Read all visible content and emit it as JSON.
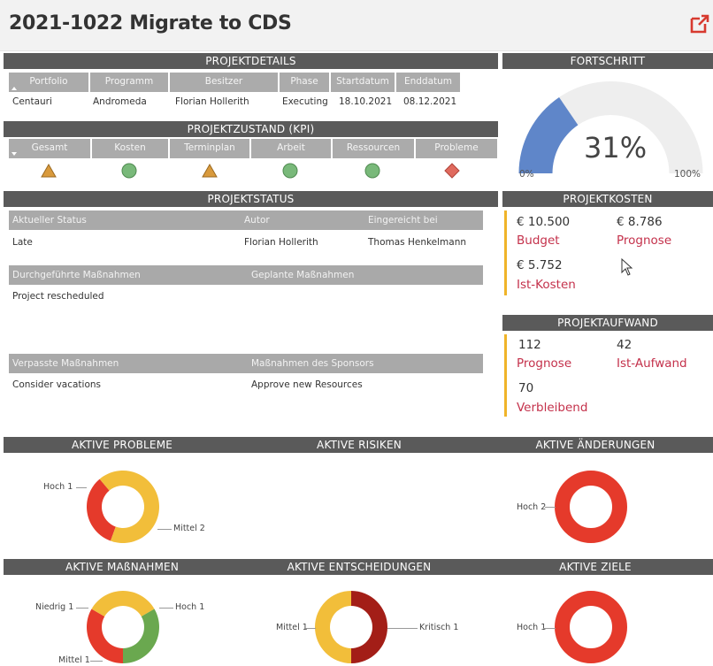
{
  "header": {
    "title": "2021-1022 Migrate to CDS"
  },
  "sections": {
    "projektdetails": "PROJEKTDETAILS",
    "fortschritt": "FORTSCHRITT",
    "projektzustand": "PROJEKTZUSTAND (KPI)",
    "projektstatus": "PROJEKTSTATUS",
    "projektkosten": "PROJEKTKOSTEN",
    "projektaufwand": "PROJEKTAUFWAND",
    "aktive_probleme": "AKTIVE PROBLEME",
    "aktive_risiken": "AKTIVE RISIKEN",
    "aktive_aenderungen": "AKTIVE ÄNDERUNGEN",
    "aktive_massnahmen": "AKTIVE MAßNAHMEN",
    "aktive_entscheidungen": "AKTIVE ENTSCHEIDUNGEN",
    "aktive_ziele": "AKTIVE ZIELE"
  },
  "details": {
    "headers": [
      "Portfolio",
      "Programm",
      "Besitzer",
      "Phase",
      "Startdatum",
      "Enddatum"
    ],
    "values": [
      "Centauri",
      "Andromeda",
      "Florian Hollerith",
      "Executing",
      "18.10.2021",
      "08.12.2021"
    ]
  },
  "kpi": {
    "headers": [
      "Gesamt",
      "Kosten",
      "Terminplan",
      "Arbeit",
      "Ressourcen",
      "Probleme"
    ],
    "indicators": [
      "triangle-warning-icon",
      "circle-ok-icon",
      "triangle-warning-icon",
      "circle-ok-icon",
      "circle-ok-icon",
      "diamond-critical-icon"
    ],
    "colors": {
      "triangle": "#d99a3c",
      "circle": "#79b97a",
      "diamond": "#e06a5e"
    }
  },
  "progress": {
    "value": 31,
    "label": "31%",
    "min_label": "0%",
    "max_label": "100%",
    "fill_color": "#5f86c9",
    "track_color": "#eeeeee"
  },
  "status": {
    "row1_headers": [
      "Aktueller Status",
      "Autor",
      "Eingereicht bei"
    ],
    "row1_values": [
      "Late",
      "Florian Hollerith",
      "Thomas Henkelmann"
    ],
    "row2_headers": [
      "Durchgeführte Maßnahmen",
      "Geplante Maßnahmen"
    ],
    "row2_values": [
      "Project rescheduled",
      ""
    ],
    "row3_headers": [
      "Verpasste Maßnahmen",
      "Maßnahmen des Sponsors"
    ],
    "row3_values": [
      "Consider vacations",
      "Approve new Resources"
    ]
  },
  "kosten": {
    "budget_value": "€ 10.500",
    "budget_label": "Budget",
    "prognose_value": "€ 8.786",
    "prognose_label": "Prognose",
    "ist_value": "€ 5.752",
    "ist_label": "Ist-Kosten"
  },
  "aufwand": {
    "prognose_value": "112",
    "prognose_label": "Prognose",
    "ist_value": "42",
    "ist_label": "Ist-Aufwand",
    "verbleibend_value": "70",
    "verbleibend_label": "Verbleibend"
  },
  "donut_labels": {
    "probleme_hoch": "Hoch 1",
    "probleme_mittel": "Mittel 2",
    "aenderungen_hoch": "Hoch 2",
    "massnahmen_niedrig": "Niedrig 1",
    "massnahmen_hoch": "Hoch 1",
    "massnahmen_mittel": "Mittel 1",
    "entscheidungen_mittel": "Mittel 1",
    "entscheidungen_kritisch": "Kritisch 1",
    "ziele_hoch": "Hoch 1"
  },
  "chart_data": [
    {
      "type": "pie",
      "title": "AKTIVE PROBLEME",
      "categories": [
        "Hoch",
        "Mittel"
      ],
      "values": [
        1,
        2
      ],
      "colors": [
        "#e53a2b",
        "#f2be3a"
      ]
    },
    {
      "type": "pie",
      "title": "AKTIVE RISIKEN",
      "categories": [],
      "values": []
    },
    {
      "type": "pie",
      "title": "AKTIVE ÄNDERUNGEN",
      "categories": [
        "Hoch"
      ],
      "values": [
        2
      ],
      "colors": [
        "#e53a2b"
      ]
    },
    {
      "type": "pie",
      "title": "AKTIVE MAßNAHMEN",
      "categories": [
        "Hoch",
        "Mittel",
        "Niedrig"
      ],
      "values": [
        1,
        1,
        1
      ],
      "colors": [
        "#e53a2b",
        "#f2be3a",
        "#6aa84f"
      ]
    },
    {
      "type": "pie",
      "title": "AKTIVE ENTSCHEIDUNGEN",
      "categories": [
        "Kritisch",
        "Mittel"
      ],
      "values": [
        1,
        1
      ],
      "colors": [
        "#a31e17",
        "#f2be3a"
      ]
    },
    {
      "type": "pie",
      "title": "AKTIVE ZIELE",
      "categories": [
        "Hoch"
      ],
      "values": [
        1
      ],
      "colors": [
        "#e53a2b"
      ]
    }
  ]
}
